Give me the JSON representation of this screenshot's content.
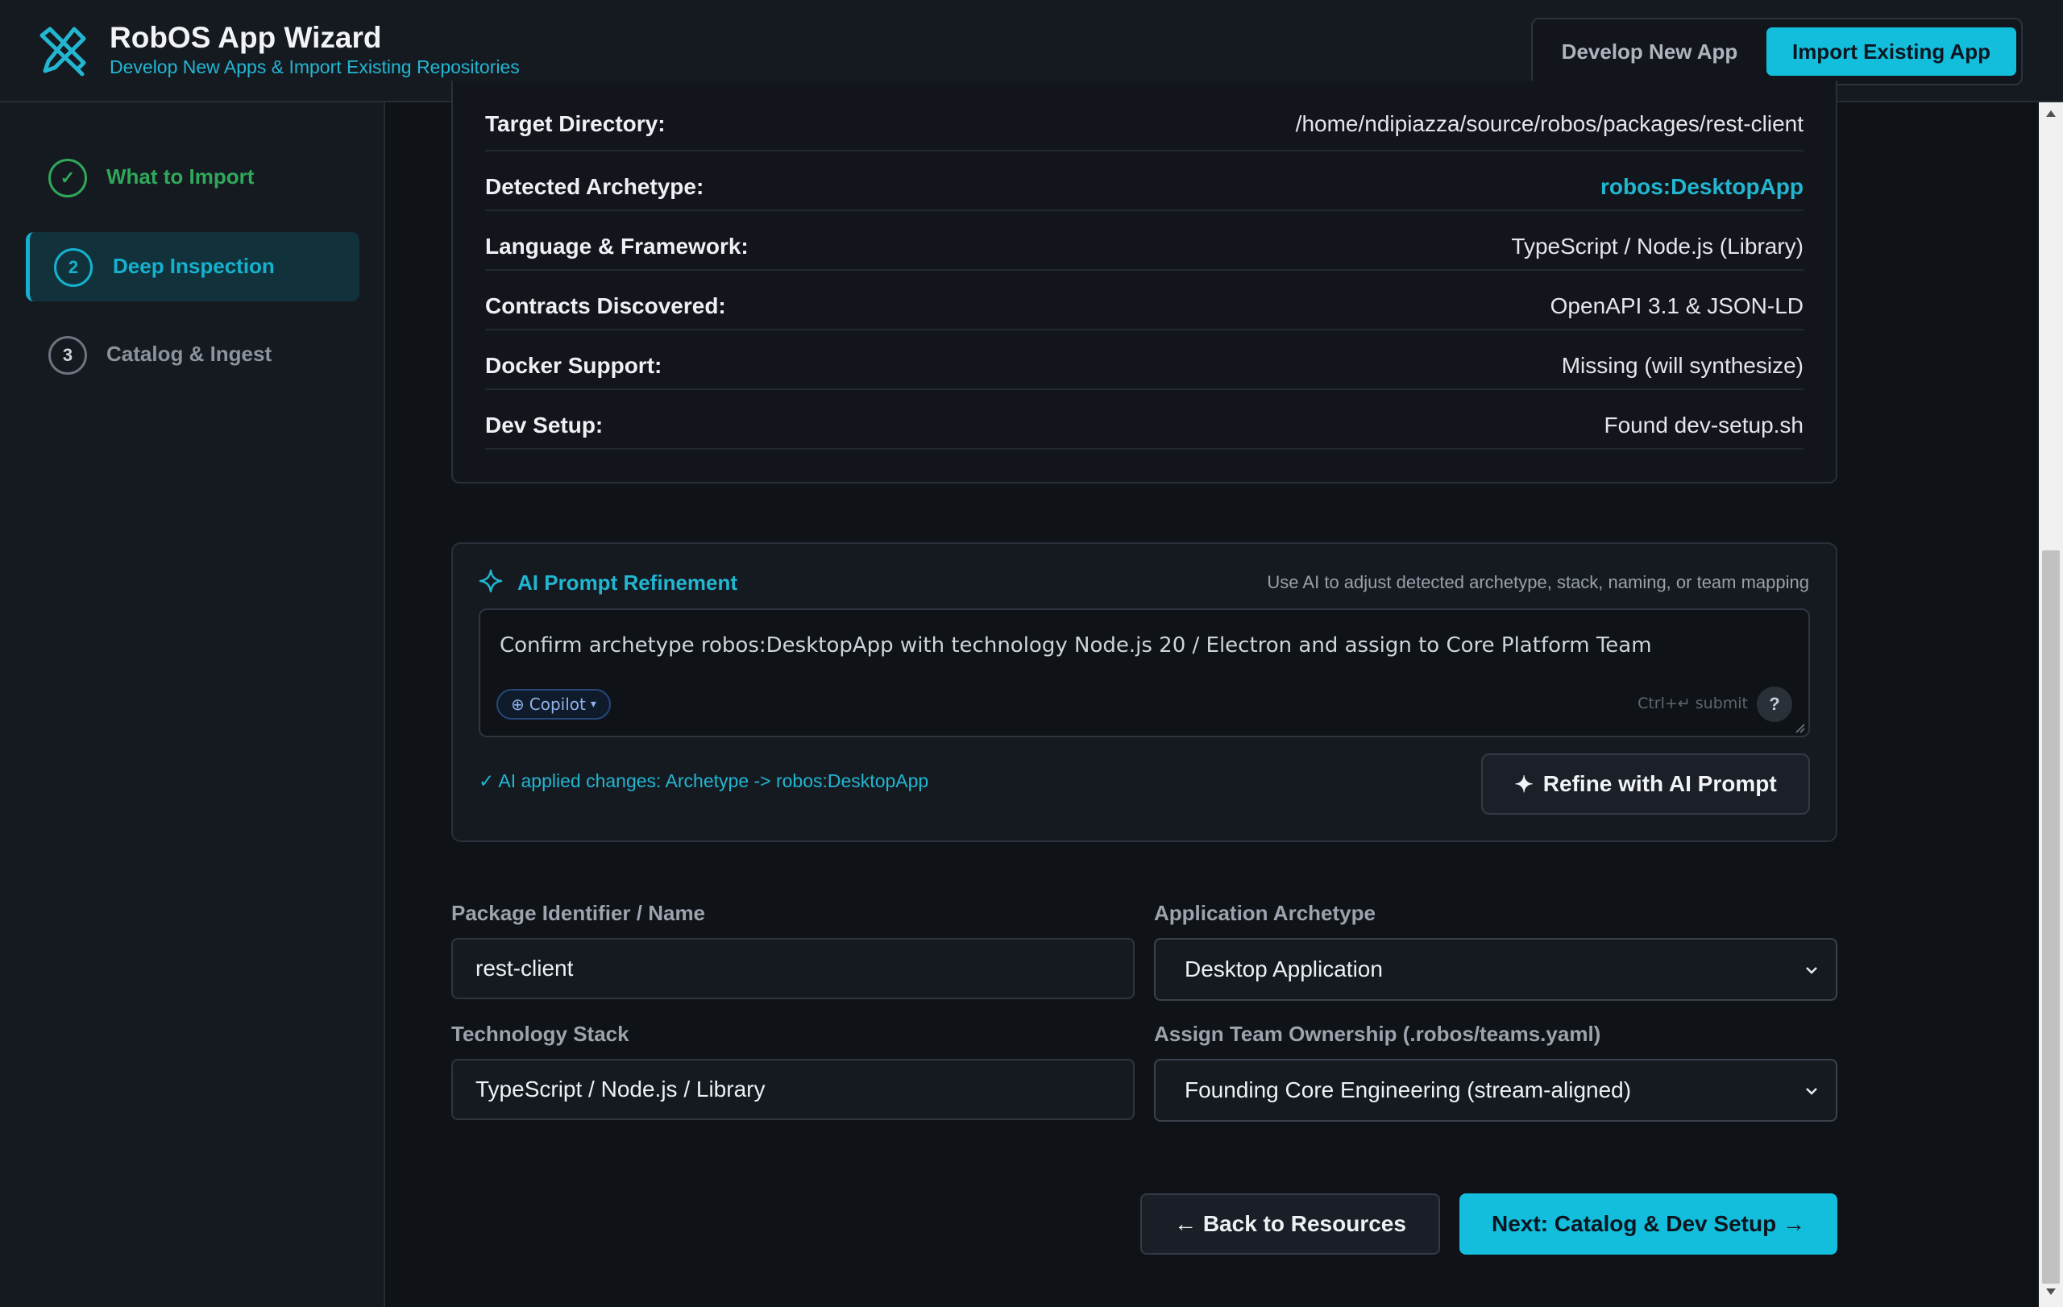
{
  "header": {
    "title": "RobOS App Wizard",
    "subtitle": "Develop New Apps & Import Existing Repositories",
    "logo_icon": "tools-icon",
    "modes": {
      "develop": "Develop New App",
      "import": "Import Existing App",
      "active": "import"
    }
  },
  "sidebar": {
    "steps": [
      {
        "number": "✓",
        "label": "What to Import",
        "state": "done"
      },
      {
        "number": "2",
        "label": "Deep Inspection",
        "state": "active"
      },
      {
        "number": "3",
        "label": "Catalog & Ingest",
        "state": "pending"
      }
    ]
  },
  "inspection": {
    "rows": [
      {
        "label": "Target Directory:",
        "value": "/home/ndipiazza/source/robos/packages/rest-client"
      },
      {
        "label": "Detected Archetype:",
        "value": "robos:DesktopApp"
      },
      {
        "label": "Language & Framework:",
        "value": "TypeScript / Node.js (Library)"
      },
      {
        "label": "Contracts Discovered:",
        "value": "OpenAPI 3.1 & JSON-LD"
      },
      {
        "label": "Docker Support:",
        "value": "Missing (will synthesize)"
      },
      {
        "label": "Dev Setup:",
        "value": "Found dev-setup.sh"
      }
    ]
  },
  "ai": {
    "title": "AI Prompt Refinement",
    "hint": "Use AI to adjust detected archetype, stack, naming, or team mapping",
    "prompt": "Confirm archetype robos:DesktopApp with technology Node.js 20 / Electron and assign to Core Platform Team",
    "copilot_label": "Copilot",
    "copilot_prefix": "⊕",
    "copilot_caret": "▾",
    "shortcut_hint": "Ctrl+↵ submit",
    "help_label": "?",
    "status": "✓ AI applied changes: Archetype -> robos:DesktopApp",
    "refine_button": "Refine with AI Prompt",
    "refine_icon": "✦"
  },
  "form": {
    "package_label": "Package Identifier / Name",
    "package_value": "rest-client",
    "archetype_label": "Application Archetype",
    "archetype_value": "Desktop Application",
    "stack_label": "Technology Stack",
    "stack_value": "TypeScript / Node.js / Library",
    "team_label": "Assign Team Ownership (.robos/teams.yaml)",
    "team_value": "Founding Core Engineering (stream-aligned)"
  },
  "nav": {
    "back": "← Back to Resources",
    "next": "Next: Catalog & Dev Setup →"
  },
  "colors": {
    "accent": "#12bedb",
    "success": "#2fa85a",
    "background": "#0f1217",
    "panel": "#151a21"
  }
}
